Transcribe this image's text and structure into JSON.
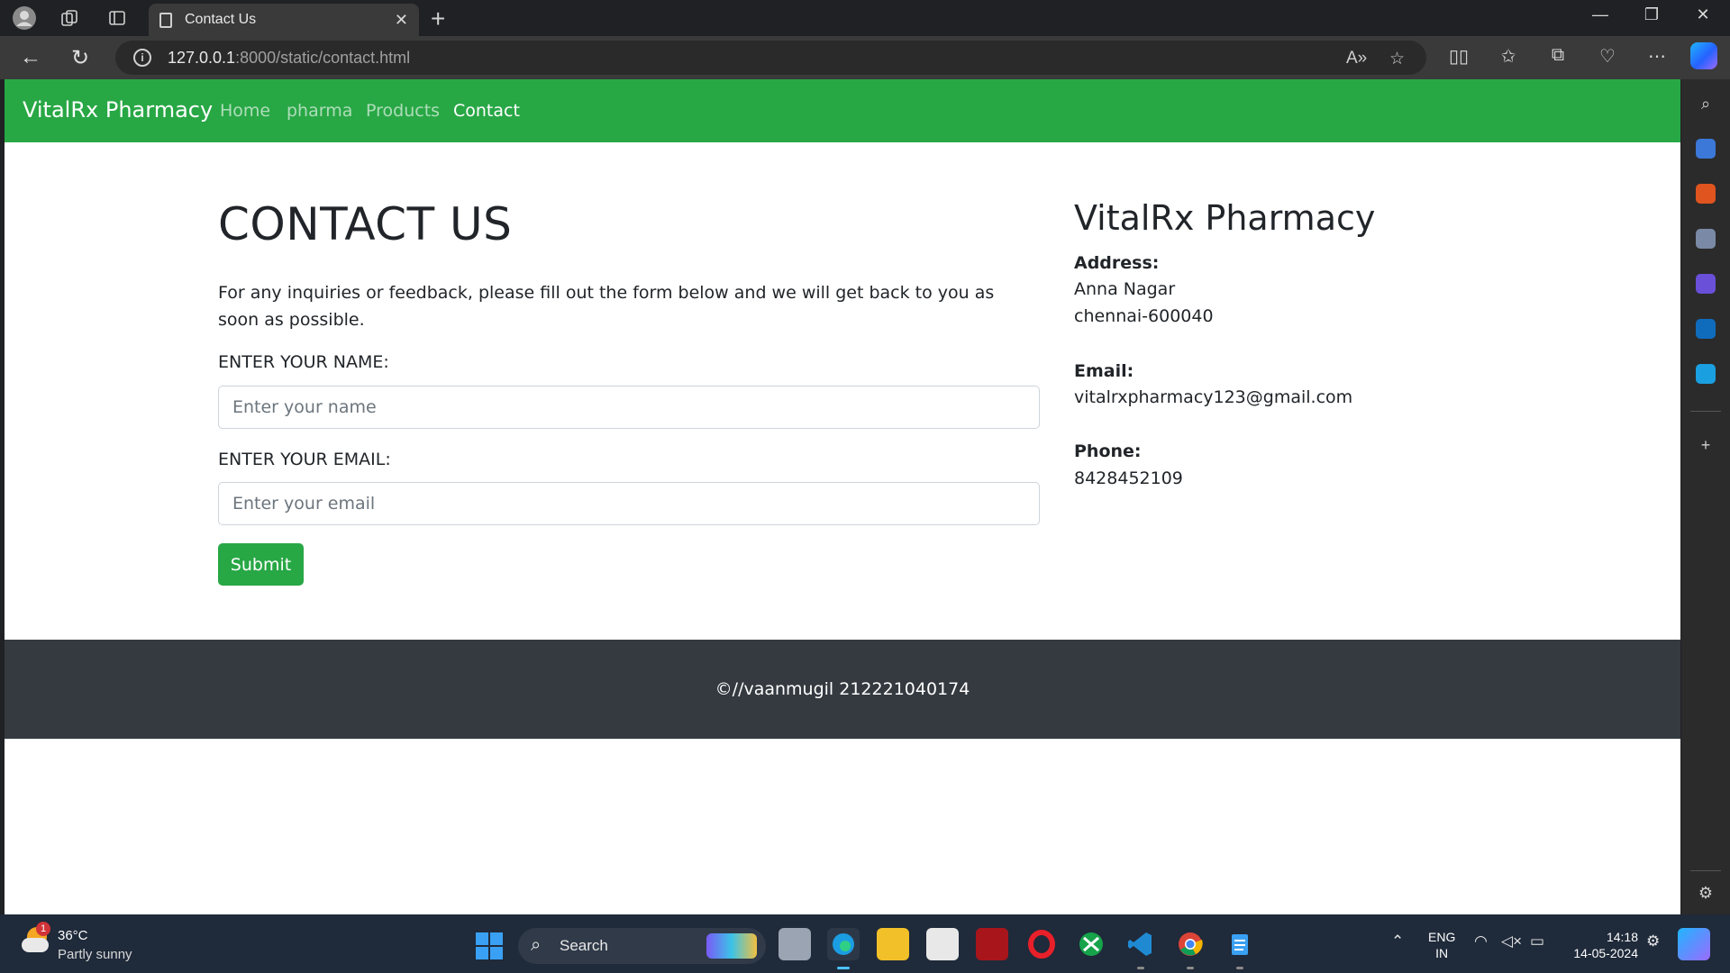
{
  "browser": {
    "tab_title": "Contact Us",
    "url_host": "127.0.0.1",
    "url_rest": ":8000/static/contact.html"
  },
  "site": {
    "brand": "VitalRx Pharmacy",
    "nav": [
      "Home",
      "pharma",
      "Products",
      "Contact"
    ],
    "active_nav": "Contact",
    "accent_color": "#28a745",
    "footer_color": "#343a40"
  },
  "contact": {
    "heading": "CONTACT US",
    "intro": "For any inquiries or feedback, please fill out the form below and we will get back to you as soon as possible.",
    "name_label": "ENTER YOUR NAME:",
    "name_placeholder": "Enter your name",
    "email_label": "ENTER YOUR EMAIL:",
    "email_placeholder": "Enter your email",
    "submit_label": "Submit"
  },
  "info": {
    "heading": "VitalRx Pharmacy",
    "address_label": "Address:",
    "address_line1": "Anna Nagar",
    "address_line2": "chennai-600040",
    "email_label": "Email:",
    "email_value": "vitalrxpharmacy123@gmail.com",
    "phone_label": "Phone:",
    "phone_value": "8428452109"
  },
  "footer": {
    "text": "©//vaanmugil 212221040174"
  },
  "taskbar": {
    "weather_badge": "1",
    "temperature": "36°C",
    "condition": "Partly sunny",
    "search_label": "Search",
    "lang_line1": "ENG",
    "lang_line2": "IN",
    "time": "14:18",
    "date": "14-05-2024"
  }
}
